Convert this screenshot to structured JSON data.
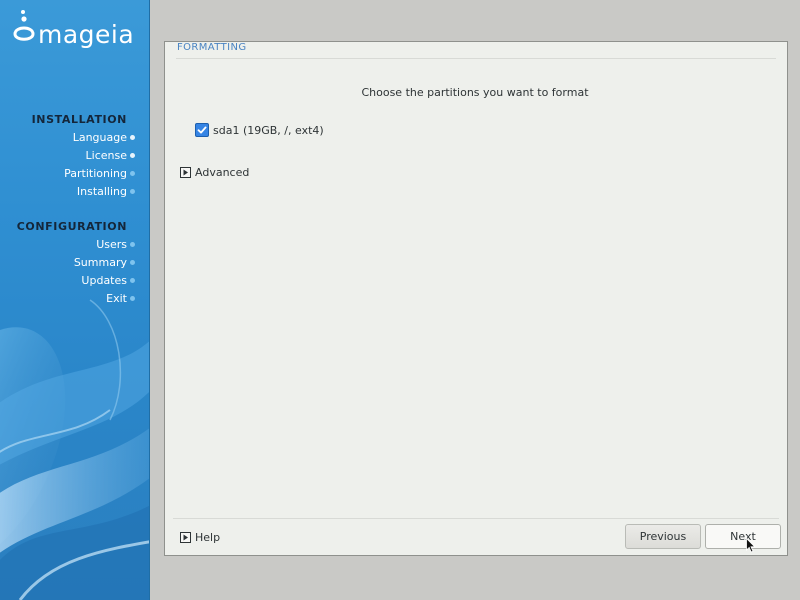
{
  "brand": {
    "name": "mageia"
  },
  "sidebar": {
    "sections": [
      {
        "heading": "INSTALLATION",
        "items": [
          {
            "label": "Language",
            "state": "done"
          },
          {
            "label": "License",
            "state": "done"
          },
          {
            "label": "Partitioning",
            "state": "pending"
          },
          {
            "label": "Installing",
            "state": "pending"
          }
        ]
      },
      {
        "heading": "CONFIGURATION",
        "items": [
          {
            "label": "Users",
            "state": "pending"
          },
          {
            "label": "Summary",
            "state": "pending"
          },
          {
            "label": "Updates",
            "state": "pending"
          },
          {
            "label": "Exit",
            "state": "pending"
          }
        ]
      }
    ]
  },
  "main": {
    "title": "FORMATTING",
    "instruction": "Choose the partitions you want to format",
    "partitions": [
      {
        "label": "sda1 (19GB, /, ext4)",
        "checked": true
      }
    ],
    "advanced_label": "Advanced",
    "help_label": "Help",
    "previous_label": "Previous",
    "next_label": "Next"
  },
  "icons": {
    "checkbox": "check-icon",
    "expander": "triangle-right-icon",
    "cursor": "mouse-pointer-icon",
    "logo": "mageia-bubbles-icon"
  },
  "colors": {
    "sidebar_blue": "#2f8fd2",
    "title_blue": "#4a84c2",
    "checkbox_blue": "#3584e4",
    "panel_bg": "#eef0ec",
    "desktop_bg": "#c9c9c6"
  }
}
